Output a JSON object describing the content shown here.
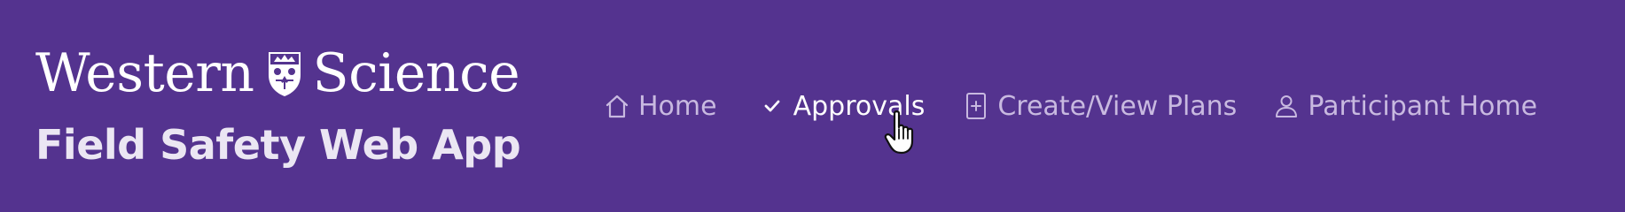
{
  "brand": {
    "logo_text_left": "Western",
    "logo_text_right": "Science",
    "app_title": "Field Safety Web App"
  },
  "nav": {
    "items": [
      {
        "label": "Home",
        "icon": "house-icon"
      },
      {
        "label": "Approvals",
        "icon": "checkmark-icon",
        "active": true
      },
      {
        "label": "Create/View Plans",
        "icon": "document-plus-icon"
      },
      {
        "label": "Participant Home",
        "icon": "person-icon"
      }
    ]
  },
  "colors": {
    "background": "#54338f",
    "nav_text": "#c8b9e0",
    "nav_active_text": "#ffffff",
    "title_text": "#ebe6f3"
  }
}
